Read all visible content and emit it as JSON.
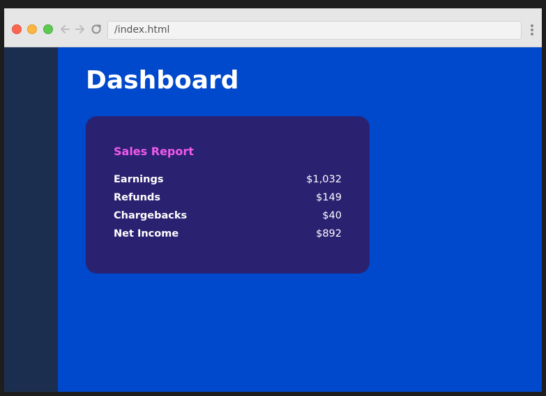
{
  "browser": {
    "address": "/index.html",
    "window_controls": [
      "close",
      "minimize",
      "maximize"
    ],
    "nav_icons": [
      "back-arrow-icon",
      "forward-arrow-icon",
      "reload-icon",
      "more-menu-icon"
    ]
  },
  "main": {
    "title": "Dashboard"
  },
  "card": {
    "title": "Sales Report",
    "rows": [
      {
        "label": "Earnings",
        "value": "$1,032"
      },
      {
        "label": "Refunds",
        "value": "$149"
      },
      {
        "label": "Chargebacks",
        "value": "$40"
      },
      {
        "label": "Net Income",
        "value": "$892"
      }
    ]
  },
  "colors": {
    "main_bg": "#0048cc",
    "sidebar_bg": "#1b2e50",
    "card_bg": "#2b2171",
    "card_title": "#f159ec"
  }
}
